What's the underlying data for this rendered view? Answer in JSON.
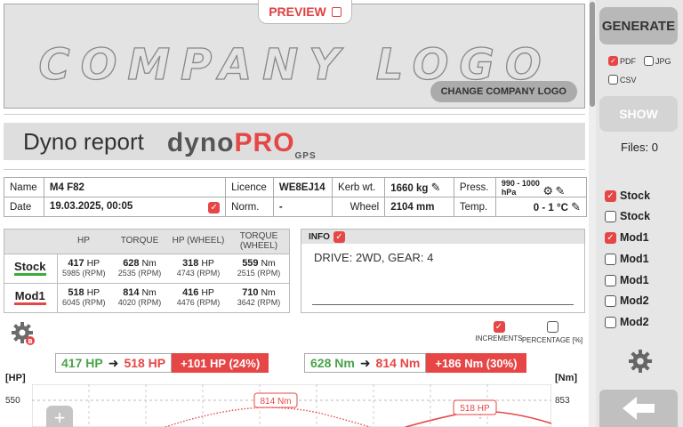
{
  "preview": {
    "label": "PREVIEW"
  },
  "logo": {
    "placeholder": "COMPANY LOGO",
    "change_label": "CHANGE COMPANY LOGO"
  },
  "report": {
    "title": "Dyno report",
    "brand": {
      "dyno": "dyno",
      "pro": "PRO",
      "gps": "GPS"
    }
  },
  "vehicle": {
    "name_label": "Name",
    "name": "M4 F82",
    "licence_label": "Licence",
    "licence": "WE8EJ14",
    "kerb_label": "Kerb wt.",
    "kerb": "1660 kg",
    "press_label": "Press.",
    "press": "990 - 1000 hPa",
    "date_label": "Date",
    "date": "19.03.2025, 00:05",
    "norm_label": "Norm.",
    "norm": "-",
    "wheel_label": "Wheel",
    "wheel": "2104 mm",
    "temp_label": "Temp.",
    "temp": "0 - 1 °C"
  },
  "results": {
    "headers": [
      "HP",
      "TORQUE",
      "HP (WHEEL)",
      "TORQUE (WHEEL)"
    ],
    "rows": [
      {
        "name": "Stock",
        "hp": "417",
        "hp_rpm": "5985 (RPM)",
        "tq": "628",
        "tq_rpm": "2535 (RPM)",
        "whp": "318",
        "whp_rpm": "4743 (RPM)",
        "wtq": "559",
        "wtq_rpm": "2515 (RPM)"
      },
      {
        "name": "Mod1",
        "hp": "518",
        "hp_rpm": "6045 (RPM)",
        "tq": "814",
        "tq_rpm": "4020 (RPM)",
        "whp": "416",
        "whp_rpm": "4476 (RPM)",
        "wtq": "710",
        "wtq_rpm": "3642 (RPM)"
      }
    ],
    "unit_hp": "HP",
    "unit_nm": "Nm"
  },
  "info": {
    "label": "INFO",
    "text": "DRIVE: 2WD,  GEAR: 4"
  },
  "options": {
    "increments": "INCREMENTS",
    "percentage": "PERCENTAGE [%]"
  },
  "compare": {
    "hp_from": "417 HP",
    "hp_to": "518 HP",
    "hp_diff": "+101 HP (24%)",
    "nm_from": "628 Nm",
    "nm_to": "814 Nm",
    "nm_diff": "+186 Nm (30%)"
  },
  "chart": {
    "left_unit": "[HP]",
    "right_unit": "[Nm]",
    "left_top": "550",
    "right_top": "853",
    "peak_nm": "814 Nm",
    "peak_hp": "518 HP"
  },
  "panel": {
    "generate": "GENERATE",
    "pdf": "PDF",
    "jpg": "JPG",
    "csv": "CSV",
    "show": "SHOW",
    "files": "Files: 0",
    "runs": [
      {
        "name": "Stock",
        "checked": true
      },
      {
        "name": "Stock",
        "checked": false
      },
      {
        "name": "Mod1",
        "checked": true
      },
      {
        "name": "Mod1",
        "checked": false
      },
      {
        "name": "Mod1",
        "checked": false
      },
      {
        "name": "Mod2",
        "checked": false
      },
      {
        "name": "Mod2",
        "checked": false
      }
    ]
  },
  "colors": {
    "accent": "#e64646",
    "stock": "#3bab3b",
    "button": "#b8b8b8"
  }
}
